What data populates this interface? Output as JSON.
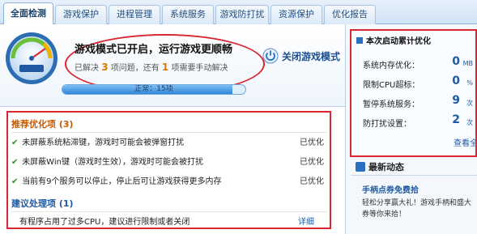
{
  "tabs": [
    {
      "label": "全面检测"
    },
    {
      "label": "游戏保护"
    },
    {
      "label": "进程管理"
    },
    {
      "label": "系统服务"
    },
    {
      "label": "游戏防打扰"
    },
    {
      "label": "资源保护"
    },
    {
      "label": "优化报告"
    }
  ],
  "active_tab": "全面检测",
  "game_mode": {
    "title": "游戏模式已开启，运行游戏更顺畅",
    "sub_prefix": "已解决",
    "solved_count": "3",
    "sub_mid": "项问题，还有",
    "manual_count": "1",
    "sub_suffix": "项需要手动解决",
    "close_button": "关闭游戏模式",
    "progress_text": "正常：15项",
    "progress_fraction": 0.93
  },
  "optimize": {
    "recommended_header": "推荐优化项 (3)",
    "recommended_items": [
      {
        "text": "未屏蔽系统粘滞键，游戏时可能会被弹窗打扰",
        "status": "已优化"
      },
      {
        "text": "未屏蔽Win键（游戏时生效），游戏时可能会被打扰",
        "status": "已优化"
      },
      {
        "text": "当前有9个服务可以停止，停止后可让游戏获得更多内存",
        "status": "已优化"
      }
    ],
    "suggest_header": "建议处理项 (1)",
    "suggest_items": [
      {
        "text": "有程序占用了过多CPU，建议进行限制或者关闭",
        "action": "详细"
      }
    ]
  },
  "stats": {
    "title": "本次启动累计优化",
    "rows": [
      {
        "label": "系统内存优化：",
        "value": "0",
        "unit": "MB"
      },
      {
        "label": "限制CPU超标：",
        "value": "0",
        "unit": "%"
      },
      {
        "label": "暂停系统服务：",
        "value": "9",
        "unit": "次"
      },
      {
        "label": "防打扰设置：",
        "value": "2",
        "unit": "次"
      }
    ],
    "view_all": "查看全"
  },
  "news": {
    "header": "最新动态",
    "title": "手柄点券免费拾",
    "body": "轻松分享赢大礼！游戏手柄和盛大券等你来拾！"
  },
  "colors": {
    "highlight_border": "#d9262f",
    "accent_blue": "#1f5aa3",
    "count_orange": "#e07800"
  }
}
